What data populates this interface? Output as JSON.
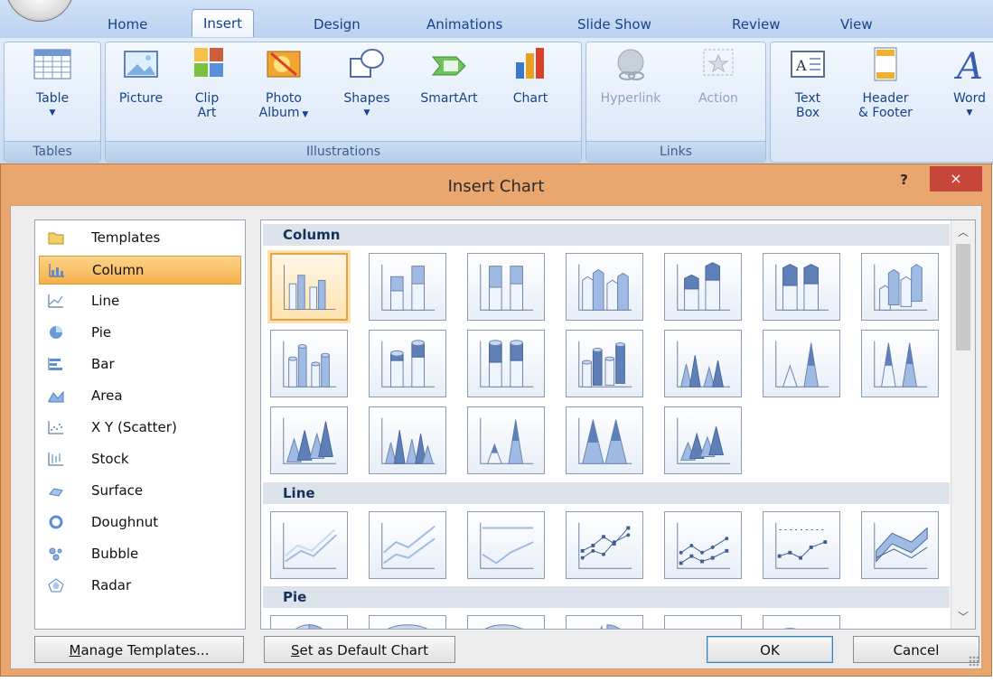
{
  "ribbon": {
    "tabs": [
      {
        "id": "home",
        "label": "Home"
      },
      {
        "id": "insert",
        "label": "Insert",
        "active": true
      },
      {
        "id": "design",
        "label": "Design"
      },
      {
        "id": "animations",
        "label": "Animations"
      },
      {
        "id": "slideshow",
        "label": "Slide Show"
      },
      {
        "id": "review",
        "label": "Review"
      },
      {
        "id": "view",
        "label": "View"
      }
    ],
    "groups": {
      "tables": {
        "label": "Tables",
        "buttons": [
          {
            "label": "Table",
            "icon": "table-icon",
            "has_dropdown": true
          }
        ]
      },
      "illustrations": {
        "label": "Illustrations",
        "buttons": [
          {
            "label": "Picture",
            "icon": "picture-icon"
          },
          {
            "label_1": "Clip",
            "label_2": "Art",
            "icon": "clip-art-icon"
          },
          {
            "label_1": "Photo",
            "label_2": "Album",
            "icon": "photo-album-icon",
            "has_dropdown": true
          },
          {
            "label": "Shapes",
            "icon": "shapes-icon",
            "has_dropdown": true
          },
          {
            "label": "SmartArt",
            "icon": "smartart-icon"
          },
          {
            "label": "Chart",
            "icon": "chart-icon"
          }
        ]
      },
      "links": {
        "label": "Links",
        "buttons": [
          {
            "label": "Hyperlink",
            "icon": "hyperlink-icon",
            "disabled": true
          },
          {
            "label": "Action",
            "icon": "action-icon",
            "disabled": true
          }
        ]
      },
      "text": {
        "buttons": [
          {
            "label_1": "Text",
            "label_2": "Box",
            "icon": "text-box-icon"
          },
          {
            "label_1": "Header",
            "label_2": "& Footer",
            "icon": "header-footer-icon"
          },
          {
            "label_1": "Word",
            "icon": "wordart-icon",
            "has_dropdown": true
          }
        ]
      }
    }
  },
  "dialog": {
    "title": "Insert Chart",
    "help": "?",
    "close": "×",
    "categories": [
      {
        "label": "Templates",
        "icon": "folder-icon"
      },
      {
        "label": "Column",
        "icon": "column-chart-icon",
        "selected": true
      },
      {
        "label": "Line",
        "icon": "line-chart-icon"
      },
      {
        "label": "Pie",
        "icon": "pie-chart-icon"
      },
      {
        "label": "Bar",
        "icon": "bar-chart-icon"
      },
      {
        "label": "Area",
        "icon": "area-chart-icon"
      },
      {
        "label": "X Y (Scatter)",
        "icon": "scatter-chart-icon"
      },
      {
        "label": "Stock",
        "icon": "stock-chart-icon"
      },
      {
        "label": "Surface",
        "icon": "surface-chart-icon"
      },
      {
        "label": "Doughnut",
        "icon": "doughnut-chart-icon"
      },
      {
        "label": "Bubble",
        "icon": "bubble-chart-icon"
      },
      {
        "label": "Radar",
        "icon": "radar-chart-icon"
      }
    ],
    "sections": [
      {
        "title": "Column",
        "visible_thumbnails": 19
      },
      {
        "title": "Line",
        "visible_thumbnails": 7
      },
      {
        "title": "Pie",
        "visible_thumbnails": 6
      }
    ],
    "buttons": {
      "manage_prefix": "M",
      "manage_rest": "anage Templates...",
      "default_prefix": "S",
      "default_rest": "et as Default Chart",
      "ok": "OK",
      "cancel": "Cancel"
    }
  },
  "colors": {
    "accent": "#f7b04a",
    "dialog_frame": "#e9a66e",
    "close": "#c7463a",
    "ribbon_text": "#15428b"
  }
}
